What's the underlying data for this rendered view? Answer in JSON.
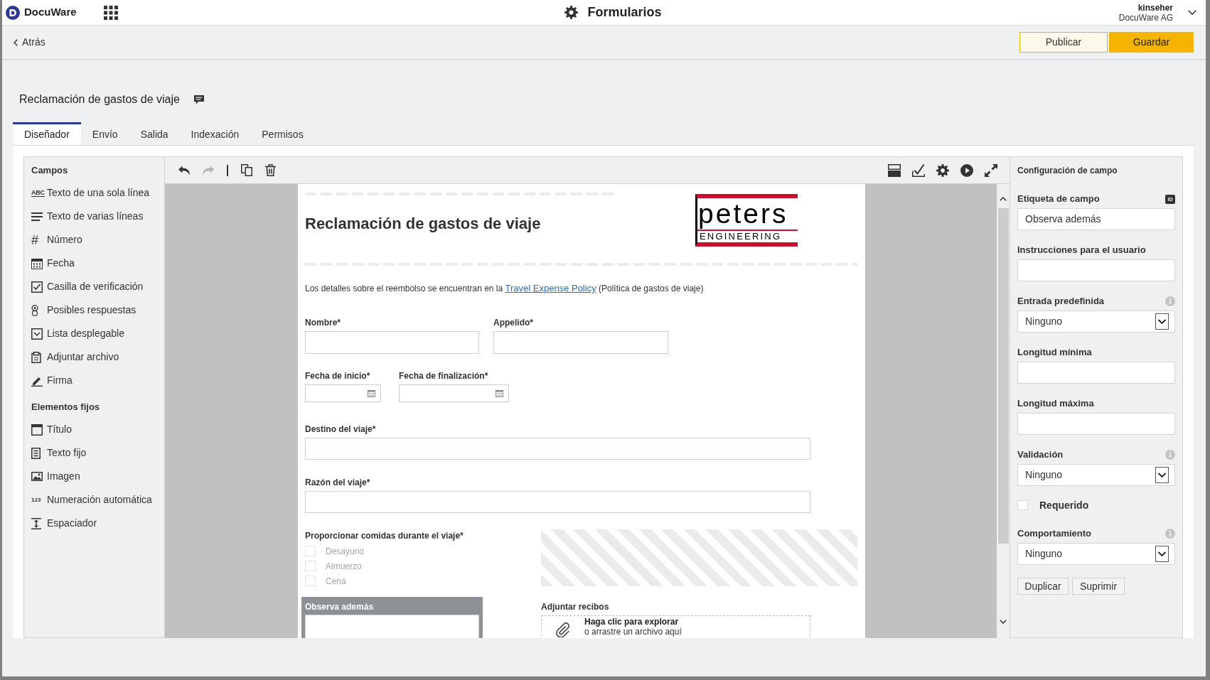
{
  "top_bar": {
    "brand": "DocuWare",
    "app_title": "Formularios",
    "user_name": "kinseher",
    "organization": "DocuWare AG"
  },
  "action_bar": {
    "back": "Atrás",
    "buttons": [
      {
        "label": "Publicar",
        "kind": "secondary"
      },
      {
        "label": "Guardar",
        "kind": "primary"
      }
    ]
  },
  "page_title": "Reclamación de gastos de viaje",
  "tabs": [
    {
      "label": "Diseñador",
      "selected": true
    },
    {
      "label": "Envío",
      "selected": false
    },
    {
      "label": "Salida",
      "selected": false
    },
    {
      "label": "Indexación",
      "selected": false
    },
    {
      "label": "Permisos",
      "selected": false
    }
  ],
  "sidebar": {
    "sections": [
      {
        "title": "Campos",
        "items": [
          {
            "label": "Texto de una sola línea",
            "kind": "text",
            "glyph": "ABC"
          },
          {
            "label": "Texto de varias líneas",
            "kind": "multiline"
          },
          {
            "label": "Número",
            "kind": "number",
            "glyph": "#"
          },
          {
            "label": "Fecha",
            "kind": "date"
          },
          {
            "label": "Casilla de verificación",
            "kind": "checkbox"
          },
          {
            "label": "Posibles respuestas",
            "kind": "choice"
          },
          {
            "label": "Lista desplegable",
            "kind": "dropdown"
          },
          {
            "label": "Adjuntar archivo",
            "kind": "attachment"
          },
          {
            "label": "Firma",
            "kind": "signature"
          }
        ]
      },
      {
        "title": "Elementos fijos",
        "items": [
          {
            "label": "Título",
            "kind": "title"
          },
          {
            "label": "Texto fijo",
            "kind": "fixedtext"
          },
          {
            "label": "Imagen",
            "kind": "image"
          },
          {
            "label": "Numeración automática",
            "kind": "autonumber",
            "glyph": "123"
          },
          {
            "label": "Espaciador",
            "kind": "spacer"
          }
        ]
      }
    ]
  },
  "toolbar": {
    "history": [
      {
        "kind": "undo",
        "disabled": false
      },
      {
        "kind": "redo",
        "disabled": true
      }
    ],
    "edit": [
      {
        "kind": "copy",
        "disabled": false
      },
      {
        "kind": "delete",
        "disabled": false
      }
    ],
    "view": [
      {
        "kind": "layout"
      },
      {
        "kind": "validate"
      },
      {
        "kind": "settings"
      },
      {
        "kind": "preview"
      },
      {
        "kind": "fullscreen"
      }
    ]
  },
  "form": {
    "title": "Reclamación de gastos de viaje",
    "logo": {
      "wordmark": "peters",
      "tagline": "ENGINEERING"
    },
    "intro": {
      "text": "Los detalles sobre el reembolso se encuentran en la",
      "link": "Travel Expense Policy",
      "after": "(Política de gastos de viaje)"
    },
    "field_rows": [
      [
        {
          "label": "Nombre*",
          "kind": "text"
        },
        {
          "label": "Appelido*",
          "kind": "text"
        }
      ],
      [
        {
          "label": "Fecha de inicio*",
          "kind": "date"
        },
        {
          "label": "Fecha de finalización*",
          "kind": "date"
        }
      ],
      [
        {
          "label": "Destino del viaje*",
          "kind": "text"
        }
      ],
      [
        {
          "label": "Razón del viaje*",
          "kind": "text"
        }
      ]
    ],
    "meals": {
      "label": "Proporcionar comidas durante el viaje*",
      "options": [
        {
          "label": "Desayuno",
          "checked": false
        },
        {
          "label": "Almuerzo",
          "checked": false
        },
        {
          "label": "Cena",
          "checked": false
        }
      ]
    },
    "notes": {
      "label": "Observa además",
      "selected": true
    },
    "upload": {
      "label": "Adjuntar recibos",
      "prompt": "Haga clic para explorar",
      "hint": "o arrastre un archivo aquí"
    }
  },
  "field_settings": {
    "title": "Configuración de campo",
    "settings": [
      {
        "label": "Etiqueta de campo",
        "kind": "input",
        "value": "Observa además",
        "badge": "ID",
        "info": false
      },
      {
        "label": "Instrucciones para el usuario",
        "kind": "input",
        "info": false
      },
      {
        "label": "Entrada predefinida",
        "kind": "select",
        "value": "Ninguno",
        "info": true
      },
      {
        "label": "Longitud mínima",
        "kind": "input",
        "info": false
      },
      {
        "label": "Longitud máxima",
        "kind": "input",
        "info": false
      },
      {
        "label": "Validación",
        "kind": "select",
        "value": "Ninguno",
        "info": true
      },
      {
        "label": "Requerido",
        "kind": "checkbox",
        "checked": false,
        "info": false
      },
      {
        "label": "Comportamiento",
        "kind": "select",
        "value": "Ninguno",
        "info": true
      }
    ],
    "buttons": [
      "Duplicar",
      "Suprimir"
    ]
  }
}
